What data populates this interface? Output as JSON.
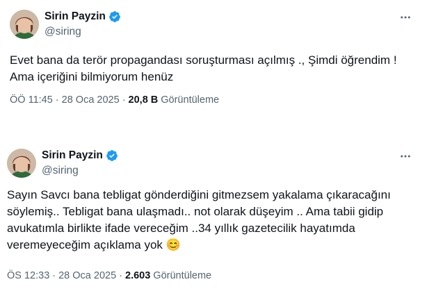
{
  "tweets": [
    {
      "author": {
        "display_name": "Sirin Payzin",
        "handle": "@siring",
        "verified_icon": "verified-badge-icon"
      },
      "text": "Evet bana da terör propagandası soruşturması açılmış ., Şimdi öğrendim !\nAma içeriğini bilmiyorum henüz",
      "time": "ÖÖ 11:45",
      "date": "28 Oca 2025",
      "separator": "·",
      "views_count": "20,8 B",
      "views_label": "Görüntüleme"
    },
    {
      "author": {
        "display_name": "Sirin Payzin",
        "handle": "@siring",
        "verified_icon": "verified-badge-icon"
      },
      "text": "Sayın Savcı bana tebligat gönderdiğini gitmezsem yakalama çıkaracağını\nsöylemiş.. Tebligat bana ulaşmadı.. not olarak düşeyim .. Ama tabii gidip\navukatımla birlikte ifade vereceğim ..34 yıllık gazetecilik hayatımda\nveremeyeceğim açıklama yok 😊",
      "time": "ÖS 12:33",
      "date": "28 Oca 2025",
      "separator": "·",
      "views_count": "2.603",
      "views_label": "Görüntüleme"
    }
  ],
  "colors": {
    "verified_blue": "#1d9bf0",
    "secondary_text": "#536471",
    "primary_text": "#0f1419"
  }
}
